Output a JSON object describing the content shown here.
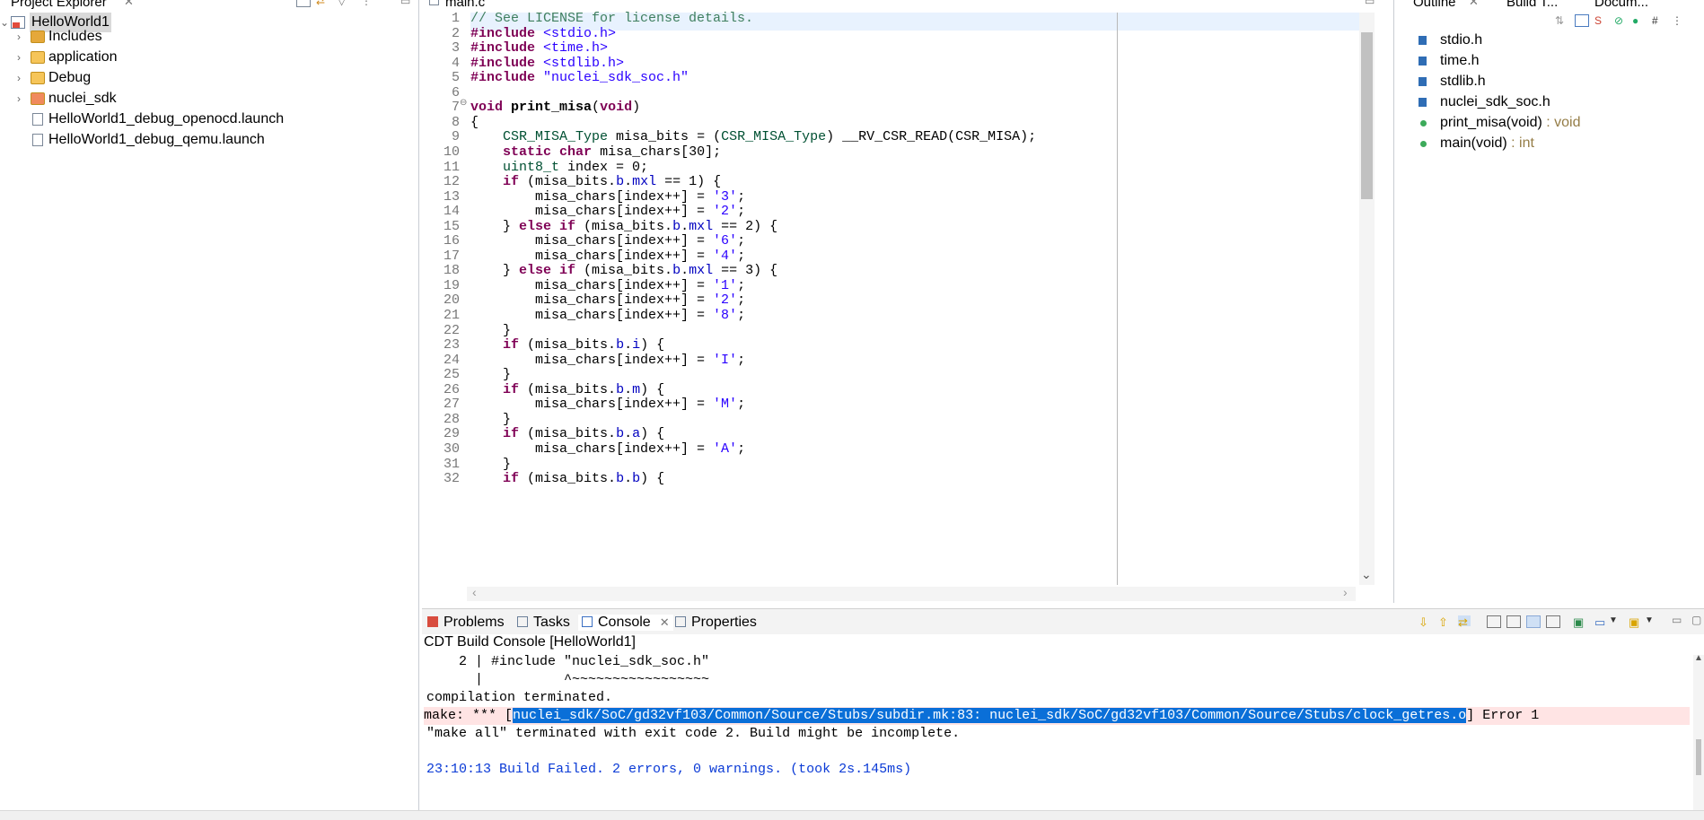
{
  "project_explorer": {
    "title": "Project Explorer",
    "items": [
      {
        "label": "HelloWorld1",
        "arrow": "v",
        "selected": true
      },
      {
        "label": "Includes",
        "arrow": ">"
      },
      {
        "label": "application",
        "arrow": ">"
      },
      {
        "label": "Debug",
        "arrow": ">"
      },
      {
        "label": "nuclei_sdk",
        "arrow": ">"
      },
      {
        "label": "HelloWorld1_debug_openocd.launch",
        "arrow": ""
      },
      {
        "label": "HelloWorld1_debug_qemu.launch",
        "arrow": ""
      }
    ]
  },
  "editor": {
    "tab_title": "main.c",
    "lines": [
      {
        "n": "1",
        "segs": [
          [
            "cm",
            "// See LICENSE for license details."
          ]
        ]
      },
      {
        "n": "2",
        "segs": [
          [
            "kw",
            "#include"
          ],
          [
            "",
            " "
          ],
          [
            "st",
            "<stdio.h>"
          ]
        ]
      },
      {
        "n": "3",
        "segs": [
          [
            "kw",
            "#include"
          ],
          [
            "",
            " "
          ],
          [
            "st",
            "<time.h>"
          ]
        ]
      },
      {
        "n": "4",
        "segs": [
          [
            "kw",
            "#include"
          ],
          [
            "",
            " "
          ],
          [
            "st",
            "<stdlib.h>"
          ]
        ]
      },
      {
        "n": "5",
        "segs": [
          [
            "kw",
            "#include"
          ],
          [
            "",
            " "
          ],
          [
            "st",
            "\"nuclei_sdk_soc.h\""
          ]
        ]
      },
      {
        "n": "6",
        "segs": []
      },
      {
        "n": "7",
        "segs": [
          [
            "kw",
            "void"
          ],
          [
            "",
            " "
          ],
          [
            "bold",
            "print_misa"
          ],
          [
            "",
            "("
          ],
          [
            "kw",
            "void"
          ],
          [
            "",
            ")"
          ]
        ]
      },
      {
        "n": "8",
        "segs": [
          [
            "",
            "{"
          ]
        ]
      },
      {
        "n": "9",
        "segs": [
          [
            "",
            "    "
          ],
          [
            "ty",
            "CSR_MISA_Type"
          ],
          [
            "",
            " misa_bits = ("
          ],
          [
            "ty",
            "CSR_MISA_Type"
          ],
          [
            "",
            ") __RV_CSR_READ(CSR_MISA);"
          ]
        ]
      },
      {
        "n": "10",
        "segs": [
          [
            "",
            "    "
          ],
          [
            "kw",
            "static"
          ],
          [
            "",
            " "
          ],
          [
            "kw",
            "char"
          ],
          [
            "",
            " misa_chars[30];"
          ]
        ]
      },
      {
        "n": "11",
        "segs": [
          [
            "",
            "    "
          ],
          [
            "ty",
            "uint8_t"
          ],
          [
            "",
            " index = 0;"
          ]
        ]
      },
      {
        "n": "12",
        "segs": [
          [
            "",
            "    "
          ],
          [
            "kw",
            "if"
          ],
          [
            "",
            " (misa_bits."
          ],
          [
            "fld",
            "b"
          ],
          [
            "",
            "."
          ],
          [
            "fld",
            "mxl"
          ],
          [
            "",
            " == 1) {"
          ]
        ]
      },
      {
        "n": "13",
        "segs": [
          [
            "",
            "        misa_chars[index++] = "
          ],
          [
            "st",
            "'3'"
          ],
          [
            "",
            ";"
          ]
        ]
      },
      {
        "n": "14",
        "segs": [
          [
            "",
            "        misa_chars[index++] = "
          ],
          [
            "st",
            "'2'"
          ],
          [
            "",
            ";"
          ]
        ]
      },
      {
        "n": "15",
        "segs": [
          [
            "",
            "    } "
          ],
          [
            "kw",
            "else if"
          ],
          [
            "",
            " (misa_bits."
          ],
          [
            "fld",
            "b"
          ],
          [
            "",
            "."
          ],
          [
            "fld",
            "mxl"
          ],
          [
            "",
            " == 2) {"
          ]
        ]
      },
      {
        "n": "16",
        "segs": [
          [
            "",
            "        misa_chars[index++] = "
          ],
          [
            "st",
            "'6'"
          ],
          [
            "",
            ";"
          ]
        ]
      },
      {
        "n": "17",
        "segs": [
          [
            "",
            "        misa_chars[index++] = "
          ],
          [
            "st",
            "'4'"
          ],
          [
            "",
            ";"
          ]
        ]
      },
      {
        "n": "18",
        "segs": [
          [
            "",
            "    } "
          ],
          [
            "kw",
            "else if"
          ],
          [
            "",
            " (misa_bits."
          ],
          [
            "fld",
            "b"
          ],
          [
            "",
            "."
          ],
          [
            "fld",
            "mxl"
          ],
          [
            "",
            " == 3) {"
          ]
        ]
      },
      {
        "n": "19",
        "segs": [
          [
            "",
            "        misa_chars[index++] = "
          ],
          [
            "st",
            "'1'"
          ],
          [
            "",
            ";"
          ]
        ]
      },
      {
        "n": "20",
        "segs": [
          [
            "",
            "        misa_chars[index++] = "
          ],
          [
            "st",
            "'2'"
          ],
          [
            "",
            ";"
          ]
        ]
      },
      {
        "n": "21",
        "segs": [
          [
            "",
            "        misa_chars[index++] = "
          ],
          [
            "st",
            "'8'"
          ],
          [
            "",
            ";"
          ]
        ]
      },
      {
        "n": "22",
        "segs": [
          [
            "",
            "    }"
          ]
        ]
      },
      {
        "n": "23",
        "segs": [
          [
            "",
            "    "
          ],
          [
            "kw",
            "if"
          ],
          [
            "",
            " (misa_bits."
          ],
          [
            "fld",
            "b"
          ],
          [
            "",
            "."
          ],
          [
            "fld",
            "i"
          ],
          [
            "",
            ") {"
          ]
        ]
      },
      {
        "n": "24",
        "segs": [
          [
            "",
            "        misa_chars[index++] = "
          ],
          [
            "st",
            "'I'"
          ],
          [
            "",
            ";"
          ]
        ]
      },
      {
        "n": "25",
        "segs": [
          [
            "",
            "    }"
          ]
        ]
      },
      {
        "n": "26",
        "segs": [
          [
            "",
            "    "
          ],
          [
            "kw",
            "if"
          ],
          [
            "",
            " (misa_bits."
          ],
          [
            "fld",
            "b"
          ],
          [
            "",
            "."
          ],
          [
            "fld",
            "m"
          ],
          [
            "",
            ") {"
          ]
        ]
      },
      {
        "n": "27",
        "segs": [
          [
            "",
            "        misa_chars[index++] = "
          ],
          [
            "st",
            "'M'"
          ],
          [
            "",
            ";"
          ]
        ]
      },
      {
        "n": "28",
        "segs": [
          [
            "",
            "    }"
          ]
        ]
      },
      {
        "n": "29",
        "segs": [
          [
            "",
            "    "
          ],
          [
            "kw",
            "if"
          ],
          [
            "",
            " (misa_bits."
          ],
          [
            "fld",
            "b"
          ],
          [
            "",
            "."
          ],
          [
            "fld",
            "a"
          ],
          [
            "",
            ") {"
          ]
        ]
      },
      {
        "n": "30",
        "segs": [
          [
            "",
            "        misa_chars[index++] = "
          ],
          [
            "st",
            "'A'"
          ],
          [
            "",
            ";"
          ]
        ]
      },
      {
        "n": "31",
        "segs": [
          [
            "",
            "    }"
          ]
        ]
      },
      {
        "n": "32",
        "segs": [
          [
            "",
            "    "
          ],
          [
            "kw",
            "if"
          ],
          [
            "",
            " (misa_bits."
          ],
          [
            "fld",
            "b"
          ],
          [
            "",
            "."
          ],
          [
            "fld",
            "b"
          ],
          [
            "",
            ") {"
          ]
        ]
      }
    ]
  },
  "outline": {
    "tabs": [
      "Outline",
      "Build T...",
      "Docum..."
    ],
    "items": [
      {
        "kind": "include",
        "label": "stdio.h",
        "ret": ""
      },
      {
        "kind": "include",
        "label": "time.h",
        "ret": ""
      },
      {
        "kind": "include",
        "label": "stdlib.h",
        "ret": ""
      },
      {
        "kind": "include",
        "label": "nuclei_sdk_soc.h",
        "ret": ""
      },
      {
        "kind": "function",
        "label": "print_misa(void)",
        "ret": " : void"
      },
      {
        "kind": "function",
        "label": "main(void)",
        "ret": " : int"
      }
    ]
  },
  "console": {
    "tabs": [
      {
        "label": "Problems",
        "active": false
      },
      {
        "label": "Tasks",
        "active": false
      },
      {
        "label": "Console",
        "active": true
      },
      {
        "label": "Properties",
        "active": false
      }
    ],
    "title": "CDT Build Console [HelloWorld1]",
    "lines": [
      {
        "text": "    2 | #include \"nuclei_sdk_soc.h\"",
        "style": ""
      },
      {
        "text": "      |          ^~~~~~~~~~~~~~~~~~",
        "style": ""
      },
      {
        "text": "compilation terminated.",
        "style": ""
      },
      {
        "pre": "make: *** [",
        "sel": "nuclei_sdk/SoC/gd32vf103/Common/Source/Stubs/subdir.mk:83: nuclei_sdk/SoC/gd32vf103/Common/Source/Stubs/clock_getres.o",
        "post": "] Error 1",
        "style": "err"
      },
      {
        "text": "\"make all\" terminated with exit code 2. Build might be incomplete.",
        "style": ""
      },
      {
        "text": "",
        "style": ""
      },
      {
        "text": "23:10:13 Build Failed. 2 errors, 0 warnings. (took 2s.145ms)",
        "style": "blue"
      }
    ]
  },
  "colors": {
    "keyword": "#7f0055",
    "comment": "#3f7f5f",
    "string": "#2a00ff",
    "type": "#005032",
    "field": "#0000c0",
    "selection": "#0a6fd8",
    "error_line_bg": "#ffe4e4",
    "build_status": "#0a3ad6"
  }
}
